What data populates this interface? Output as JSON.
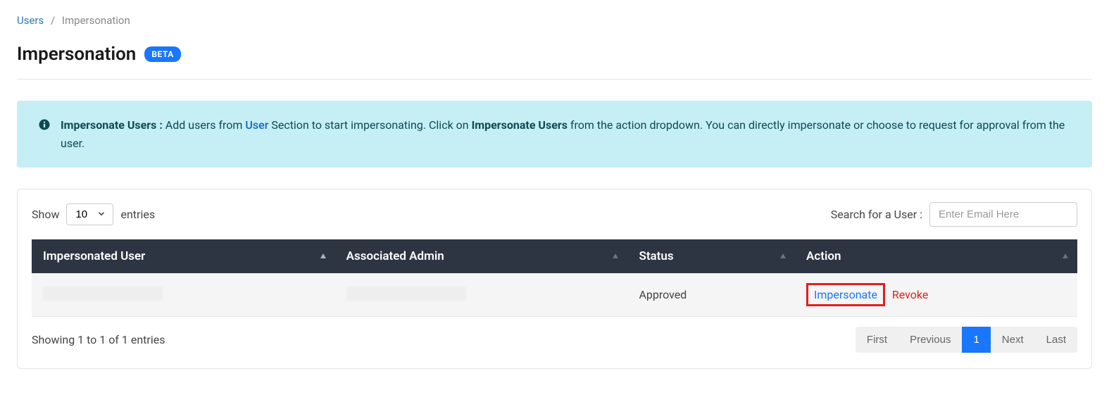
{
  "breadcrumb": {
    "parent": "Users",
    "separator": "/",
    "current": "Impersonation"
  },
  "header": {
    "title": "Impersonation",
    "badge": "BETA"
  },
  "info": {
    "bold_lead": "Impersonate Users :",
    "text_before_link": " Add users from ",
    "link_text": "User",
    "text_mid": " Section to start impersonating. Click on ",
    "bold_mid": "Impersonate Users",
    "text_after": " from the action dropdown. You can directly impersonate or choose to request for approval from the user."
  },
  "table_controls": {
    "show_label": "Show",
    "entries_value": "10",
    "entries_label": "entries",
    "search_label": "Search for a User :",
    "search_placeholder": "Enter Email Here"
  },
  "table": {
    "headers": {
      "col1": "Impersonated User",
      "col2": "Associated Admin",
      "col3": "Status",
      "col4": "Action"
    },
    "row1": {
      "status": "Approved",
      "action_impersonate": "Impersonate",
      "action_revoke": "Revoke"
    }
  },
  "footer": {
    "info": "Showing 1 to 1 of 1 entries",
    "first": "First",
    "previous": "Previous",
    "page1": "1",
    "next": "Next",
    "last": "Last"
  }
}
